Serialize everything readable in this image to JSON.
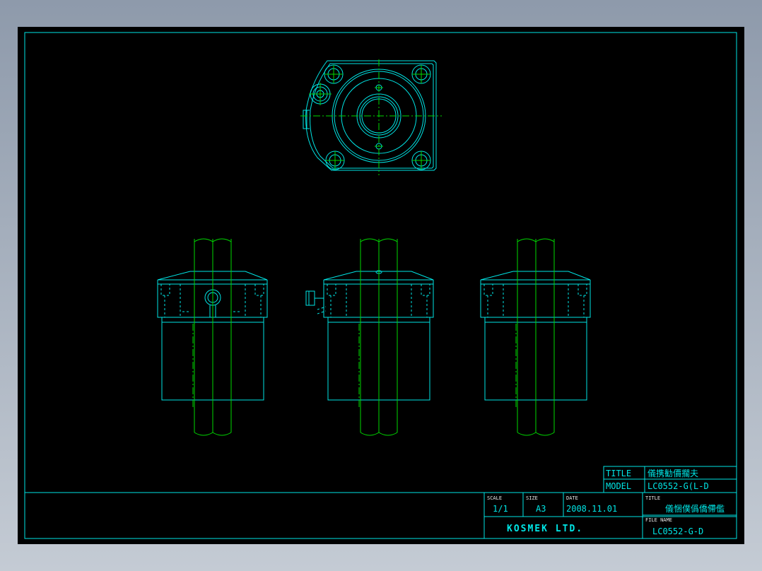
{
  "upper_block": {
    "title_label": "TITLE",
    "title_value": "儀携勧價擱夫",
    "model_label": "MODEL",
    "model_value": "LC0552-G(L-D"
  },
  "title_block": {
    "scale_label": "SCALE",
    "scale_value": "1/1",
    "size_label": "SIZE",
    "size_value": "A3",
    "date_label": "DATE",
    "date_value": "2008.11.01",
    "title_label": "TITLE",
    "title_value": "儀悃僕僞僑僀儖",
    "company": "KOSMEK LTD.",
    "file_label": "FILE NAME",
    "file_value": "LC0552-G-D"
  },
  "colors": {
    "background": "#000000",
    "line_cyan": "#00e5e5",
    "line_green": "#00d800",
    "window": "#a9b3c0"
  }
}
